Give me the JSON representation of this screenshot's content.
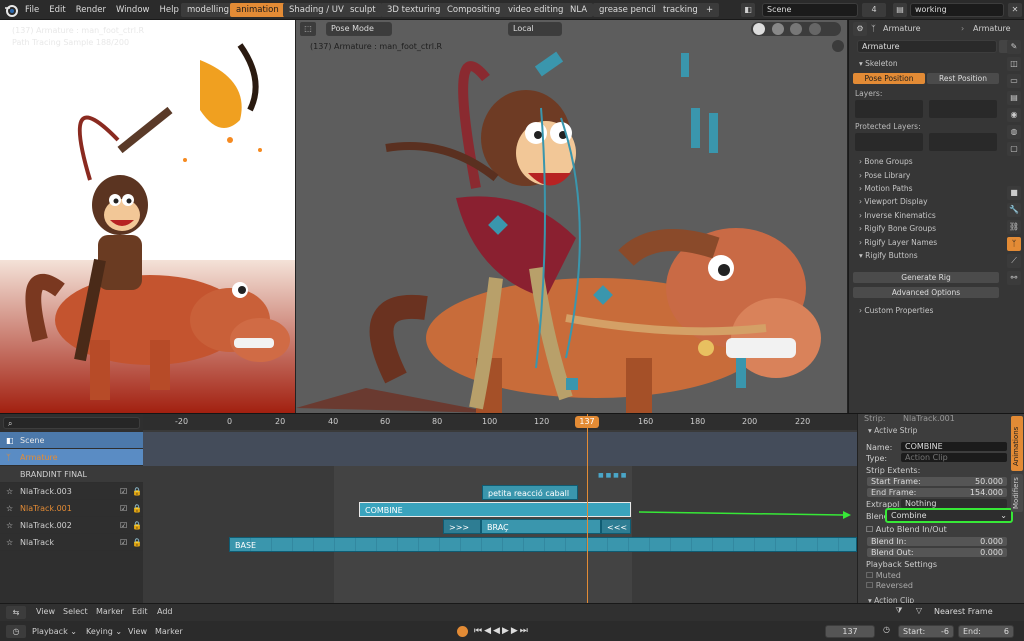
{
  "menu": [
    "File",
    "Edit",
    "Render",
    "Window",
    "Help"
  ],
  "workspace_tabs": [
    {
      "label": "modelling",
      "active": false
    },
    {
      "label": "animation",
      "active": true
    },
    {
      "label": "Shading / UV",
      "active": false
    },
    {
      "label": "sculpt",
      "active": false
    },
    {
      "label": "3D texturing",
      "active": false
    },
    {
      "label": "Compositing",
      "active": false
    },
    {
      "label": "video editing",
      "active": false
    },
    {
      "label": "NLA",
      "active": false
    },
    {
      "label": "grease pencil",
      "active": false
    },
    {
      "label": "tracking",
      "active": false
    }
  ],
  "add_tab": "+",
  "scene": {
    "name": "Scene",
    "users": "4"
  },
  "view_layer": "working",
  "render_view": {
    "info_line1": "(137) Armature : man_foot_ctrl.R",
    "info_line2": "Path Tracing Sample 188/200"
  },
  "viewport": {
    "mode": "Pose Mode",
    "orientation": "Local",
    "info": "(137) Armature : man_foot_ctrl.R"
  },
  "properties": {
    "header_object": "Armature",
    "header_data": "Armature",
    "data_name": "Armature",
    "skeleton_label": "Skeleton",
    "pose_position": "Pose Position",
    "rest_position": "Rest Position",
    "layers_label": "Layers:",
    "protected_layers_label": "Protected Layers:",
    "panels": [
      "Bone Groups",
      "Pose Library",
      "Motion Paths",
      "Viewport Display",
      "Inverse Kinematics",
      "Rigify Bone Groups",
      "Rigify Layer Names",
      "Rigify Buttons"
    ],
    "generate_rig": "Generate Rig",
    "advanced_options": "Advanced Options",
    "custom_properties": "Custom Properties"
  },
  "nla": {
    "search_placeholder": "",
    "ruler": [
      "-20",
      "0",
      "20",
      "40",
      "60",
      "80",
      "100",
      "120",
      "137",
      "160",
      "180",
      "200",
      "220"
    ],
    "current_frame": "137",
    "tracks": [
      {
        "name": "Scene",
        "style": "scene"
      },
      {
        "name": "Armature",
        "style": "object"
      },
      {
        "name": "BRANDINT FINAL",
        "style": "action"
      },
      {
        "name": "NlaTrack.003",
        "style": "track"
      },
      {
        "name": "NlaTrack.001",
        "style": "track-active"
      },
      {
        "name": "NlaTrack.002",
        "style": "track"
      },
      {
        "name": "NlaTrack",
        "style": "track"
      }
    ],
    "strips": {
      "petita": "petita reacció caball",
      "combine": "COMBINE",
      "fwd": ">>>",
      "brac": "BRAÇ",
      "back": "<<<",
      "base": "BASE"
    },
    "keys_marker": "■ ■ ■ ■"
  },
  "strip_sidebar": {
    "top_label": "Strip:",
    "top_value": "NlaTrack.001",
    "active_strip": "Active Strip",
    "name_label": "Name:",
    "name_value": "COMBINE",
    "type_label": "Type:",
    "type_value": "Action Clip",
    "extents_label": "Strip Extents:",
    "start_label": "Start Frame:",
    "start_value": "50.000",
    "end_label": "End Frame:",
    "end_value": "154.000",
    "extrapolation_label": "Extrapol:",
    "extrapolation_value": "Nothing",
    "blending_label": "Blending:",
    "blending_value": "Combine",
    "auto_blend": "Auto Blend In/Out",
    "blend_in_label": "Blend In:",
    "blend_in_value": "0.000",
    "blend_out_label": "Blend Out:",
    "blend_out_value": "0.000",
    "playback_label": "Playback Settings",
    "muted": "Muted",
    "reversed": "Reversed",
    "action_clip": "Action Clip",
    "side_tabs": [
      "Animations",
      "Modifiers"
    ]
  },
  "nla_header": {
    "view": "View",
    "select": "Select",
    "marker": "Marker",
    "edit": "Edit",
    "add": "Add",
    "snap": "Nearest Frame"
  },
  "timeline": {
    "playback": "Playback",
    "keying": "Keying",
    "view": "View",
    "marker": "Marker",
    "frame": "137",
    "start_label": "Start:",
    "start_value": "-6",
    "end_label": "End:",
    "end_value": "6"
  },
  "colors": {
    "accent": "#e38b35",
    "strip": "#3a96ad",
    "highlight": "#37e837"
  }
}
